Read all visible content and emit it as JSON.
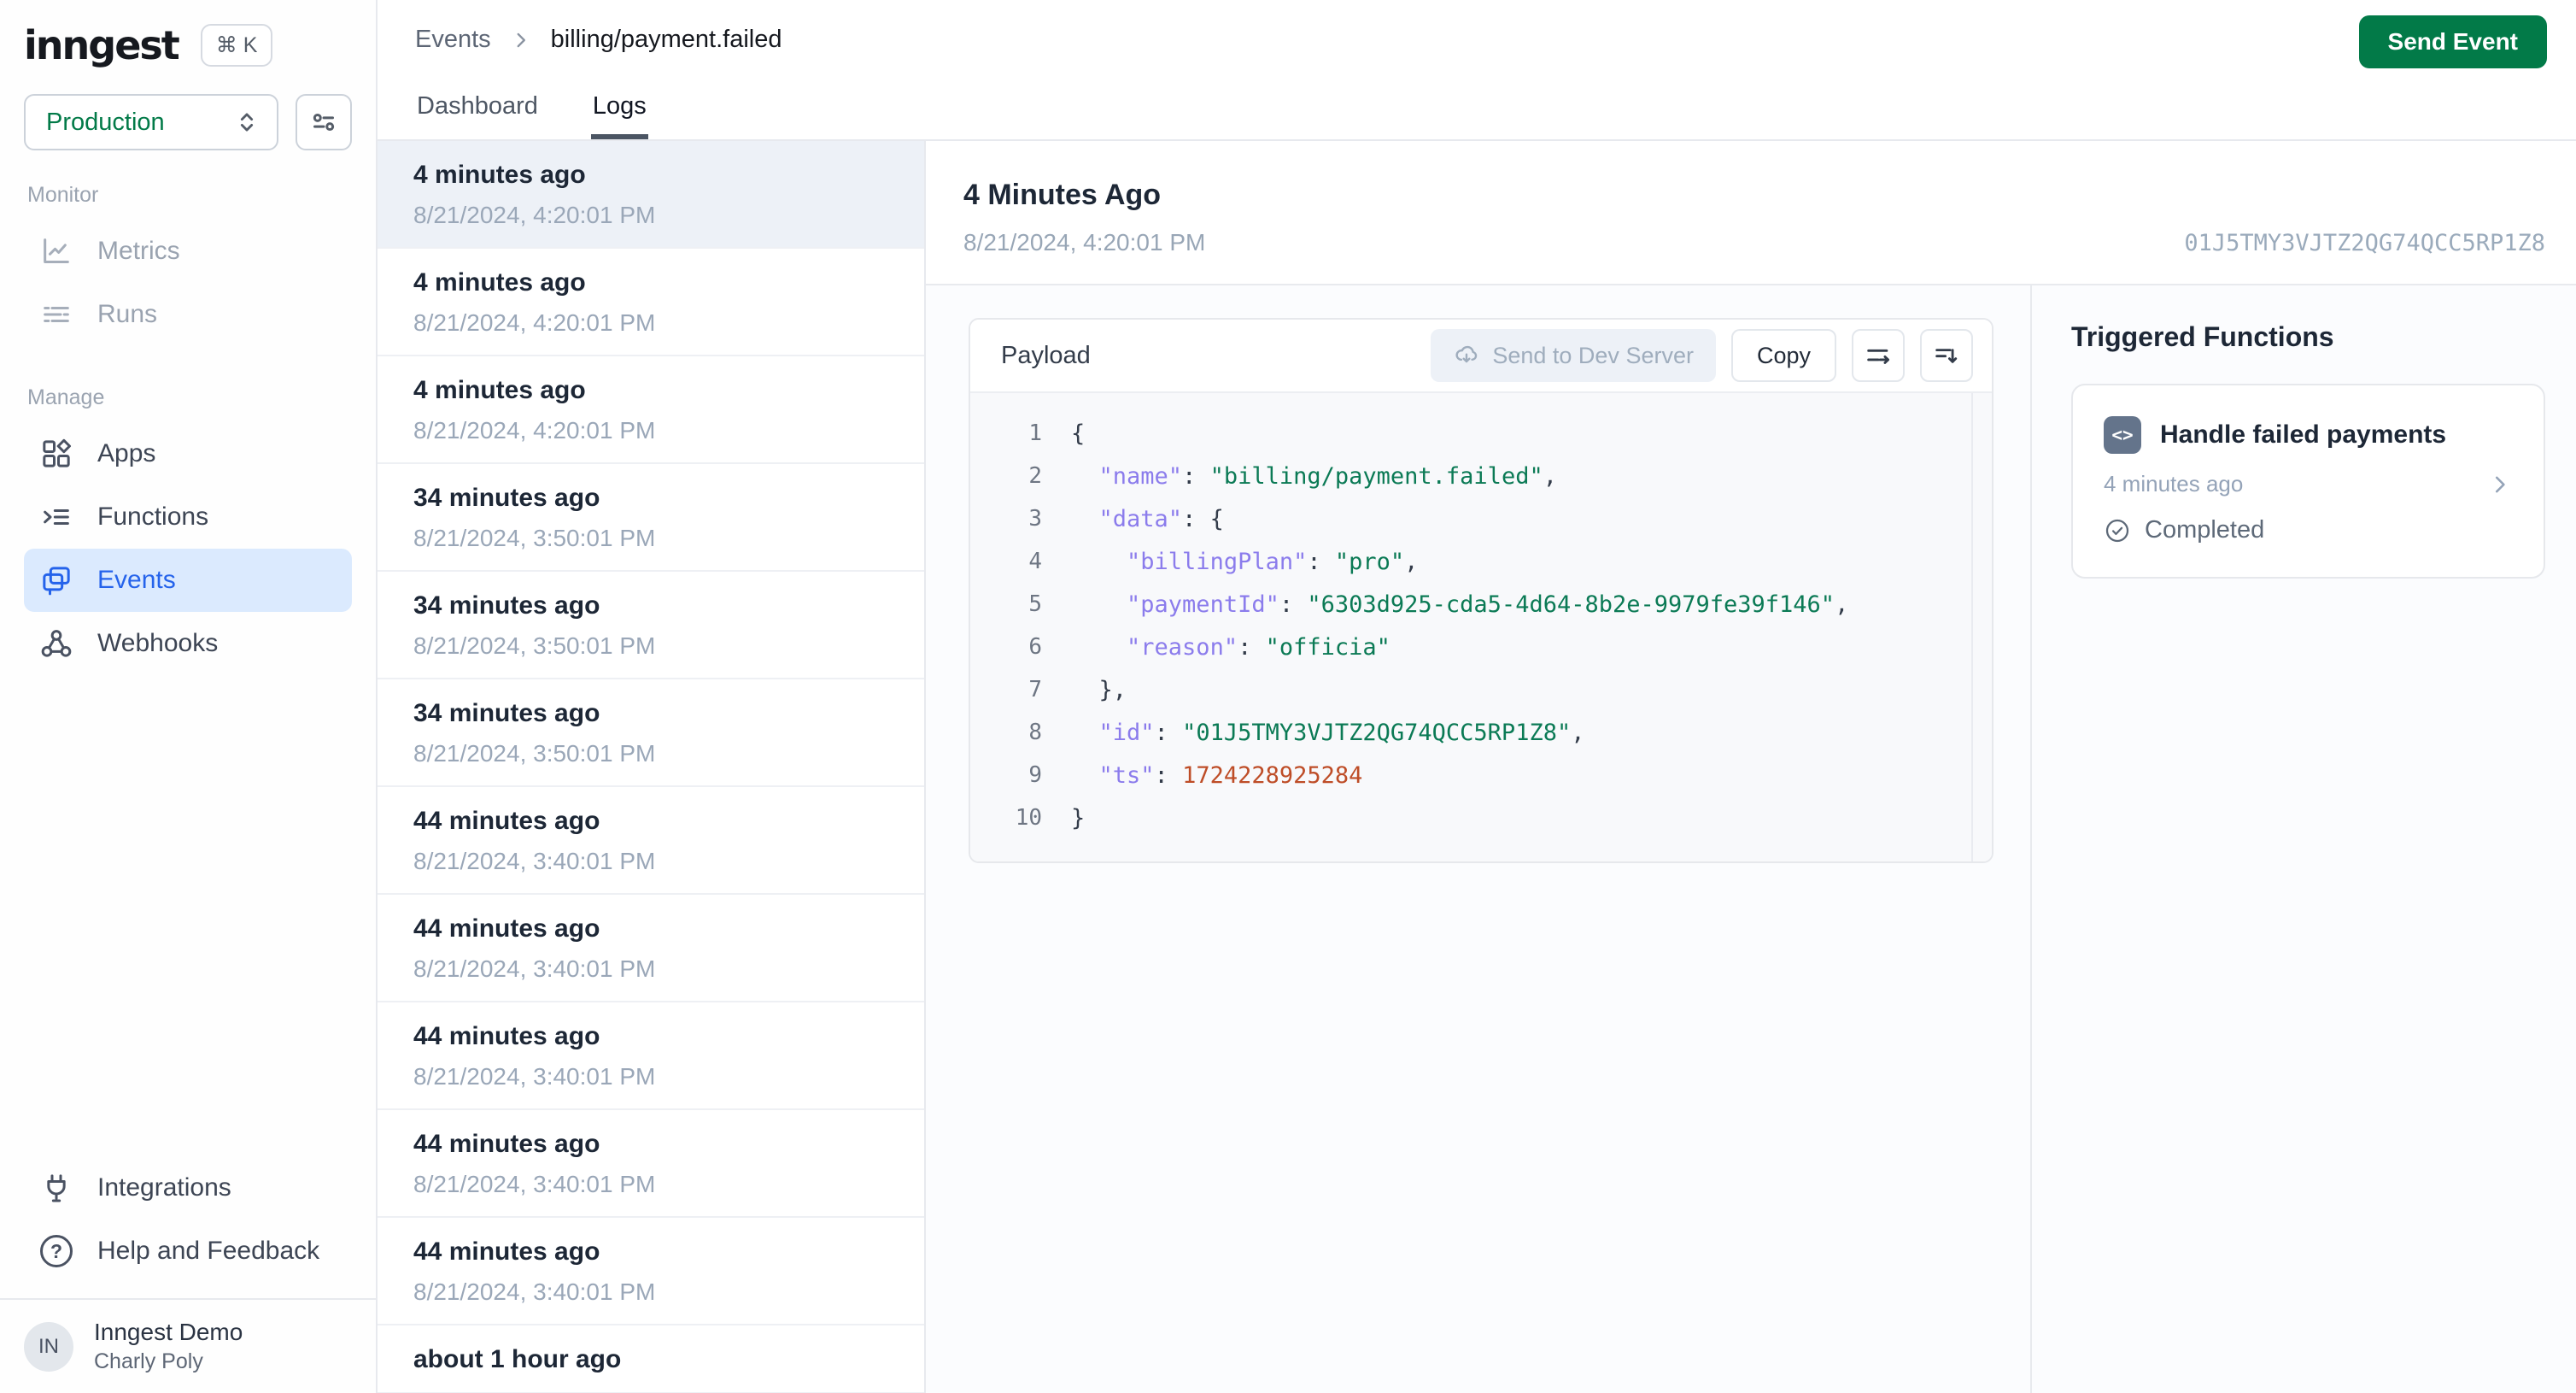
{
  "colors": {
    "accent_green": "#027a48",
    "active_blue": "#2563eb",
    "active_blue_bg": "#dbeafe",
    "json_key": "#8b7cec",
    "json_string": "#0b7a55",
    "json_number": "#be4d27"
  },
  "brand": {
    "logo_text": "inngest",
    "shortcut": "⌘ K"
  },
  "env_selector": {
    "value": "Production"
  },
  "sidebar": {
    "sections": [
      {
        "label": "Monitor",
        "items": [
          {
            "label": "Metrics",
            "icon": "metrics-icon",
            "state": "disabled"
          },
          {
            "label": "Runs",
            "icon": "runs-icon",
            "state": "disabled"
          }
        ]
      },
      {
        "label": "Manage",
        "items": [
          {
            "label": "Apps",
            "icon": "apps-icon",
            "state": "default"
          },
          {
            "label": "Functions",
            "icon": "functions-icon",
            "state": "default"
          },
          {
            "label": "Events",
            "icon": "events-icon",
            "state": "active"
          },
          {
            "label": "Webhooks",
            "icon": "webhooks-icon",
            "state": "default"
          }
        ]
      }
    ],
    "footer_items": [
      {
        "label": "Integrations",
        "icon": "integrations-icon",
        "state": "default"
      },
      {
        "label": "Help and Feedback",
        "icon": "help-icon",
        "state": "default"
      }
    ],
    "user": {
      "avatar_initials": "IN",
      "name": "Inngest Demo",
      "subtitle": "Charly Poly"
    }
  },
  "topbar": {
    "breadcrumb": {
      "root": "Events",
      "leaf": "billing/payment.failed"
    },
    "tabs": [
      {
        "label": "Dashboard",
        "active": false
      },
      {
        "label": "Logs",
        "active": true
      }
    ],
    "send_event_label": "Send Event"
  },
  "event_list": [
    {
      "title": "4 minutes ago",
      "timestamp": "8/21/2024, 4:20:01 PM",
      "selected": true
    },
    {
      "title": "4 minutes ago",
      "timestamp": "8/21/2024, 4:20:01 PM",
      "selected": false
    },
    {
      "title": "4 minutes ago",
      "timestamp": "8/21/2024, 4:20:01 PM",
      "selected": false
    },
    {
      "title": "34 minutes ago",
      "timestamp": "8/21/2024, 3:50:01 PM",
      "selected": false
    },
    {
      "title": "34 minutes ago",
      "timestamp": "8/21/2024, 3:50:01 PM",
      "selected": false
    },
    {
      "title": "34 minutes ago",
      "timestamp": "8/21/2024, 3:50:01 PM",
      "selected": false
    },
    {
      "title": "44 minutes ago",
      "timestamp": "8/21/2024, 3:40:01 PM",
      "selected": false
    },
    {
      "title": "44 minutes ago",
      "timestamp": "8/21/2024, 3:40:01 PM",
      "selected": false
    },
    {
      "title": "44 minutes ago",
      "timestamp": "8/21/2024, 3:40:01 PM",
      "selected": false
    },
    {
      "title": "44 minutes ago",
      "timestamp": "8/21/2024, 3:40:01 PM",
      "selected": false
    },
    {
      "title": "44 minutes ago",
      "timestamp": "8/21/2024, 3:40:01 PM",
      "selected": false
    },
    {
      "title": "about 1 hour ago",
      "timestamp": "",
      "selected": false
    }
  ],
  "detail": {
    "title": "4 Minutes Ago",
    "timestamp": "8/21/2024, 4:20:01 PM",
    "event_id": "01J5TMY3VJTZ2QG74QCC5RP1Z8",
    "payload": {
      "title": "Payload",
      "send_to_dev_server_label": "Send to Dev Server",
      "copy_label": "Copy",
      "code_lines": [
        {
          "n": "1",
          "toks": [
            [
              "pun",
              "{"
            ]
          ]
        },
        {
          "n": "2",
          "toks": [
            [
              "pun",
              "  "
            ],
            [
              "key",
              "\"name\""
            ],
            [
              "pun",
              ": "
            ],
            [
              "str",
              "\"billing/payment.failed\""
            ],
            [
              "pun",
              ","
            ]
          ]
        },
        {
          "n": "3",
          "toks": [
            [
              "pun",
              "  "
            ],
            [
              "key",
              "\"data\""
            ],
            [
              "pun",
              ": {"
            ]
          ]
        },
        {
          "n": "4",
          "toks": [
            [
              "pun",
              "    "
            ],
            [
              "key",
              "\"billingPlan\""
            ],
            [
              "pun",
              ": "
            ],
            [
              "str",
              "\"pro\""
            ],
            [
              "pun",
              ","
            ]
          ]
        },
        {
          "n": "5",
          "toks": [
            [
              "pun",
              "    "
            ],
            [
              "key",
              "\"paymentId\""
            ],
            [
              "pun",
              ": "
            ],
            [
              "str",
              "\"6303d925-cda5-4d64-8b2e-9979fe39f146\""
            ],
            [
              "pun",
              ","
            ]
          ]
        },
        {
          "n": "6",
          "toks": [
            [
              "pun",
              "    "
            ],
            [
              "key",
              "\"reason\""
            ],
            [
              "pun",
              ": "
            ],
            [
              "str",
              "\"officia\""
            ]
          ]
        },
        {
          "n": "7",
          "toks": [
            [
              "pun",
              "  },"
            ]
          ]
        },
        {
          "n": "8",
          "toks": [
            [
              "pun",
              "  "
            ],
            [
              "key",
              "\"id\""
            ],
            [
              "pun",
              ": "
            ],
            [
              "str",
              "\"01J5TMY3VJTZ2QG74QCC5RP1Z8\""
            ],
            [
              "pun",
              ","
            ]
          ]
        },
        {
          "n": "9",
          "toks": [
            [
              "pun",
              "  "
            ],
            [
              "key",
              "\"ts\""
            ],
            [
              "pun",
              ": "
            ],
            [
              "num",
              "1724228925284"
            ]
          ]
        },
        {
          "n": "10",
          "toks": [
            [
              "pun",
              "}"
            ]
          ]
        }
      ]
    },
    "triggered_functions": {
      "title": "Triggered Functions",
      "cards": [
        {
          "name": "Handle failed payments",
          "time": "4 minutes ago",
          "status": "Completed"
        }
      ]
    }
  }
}
